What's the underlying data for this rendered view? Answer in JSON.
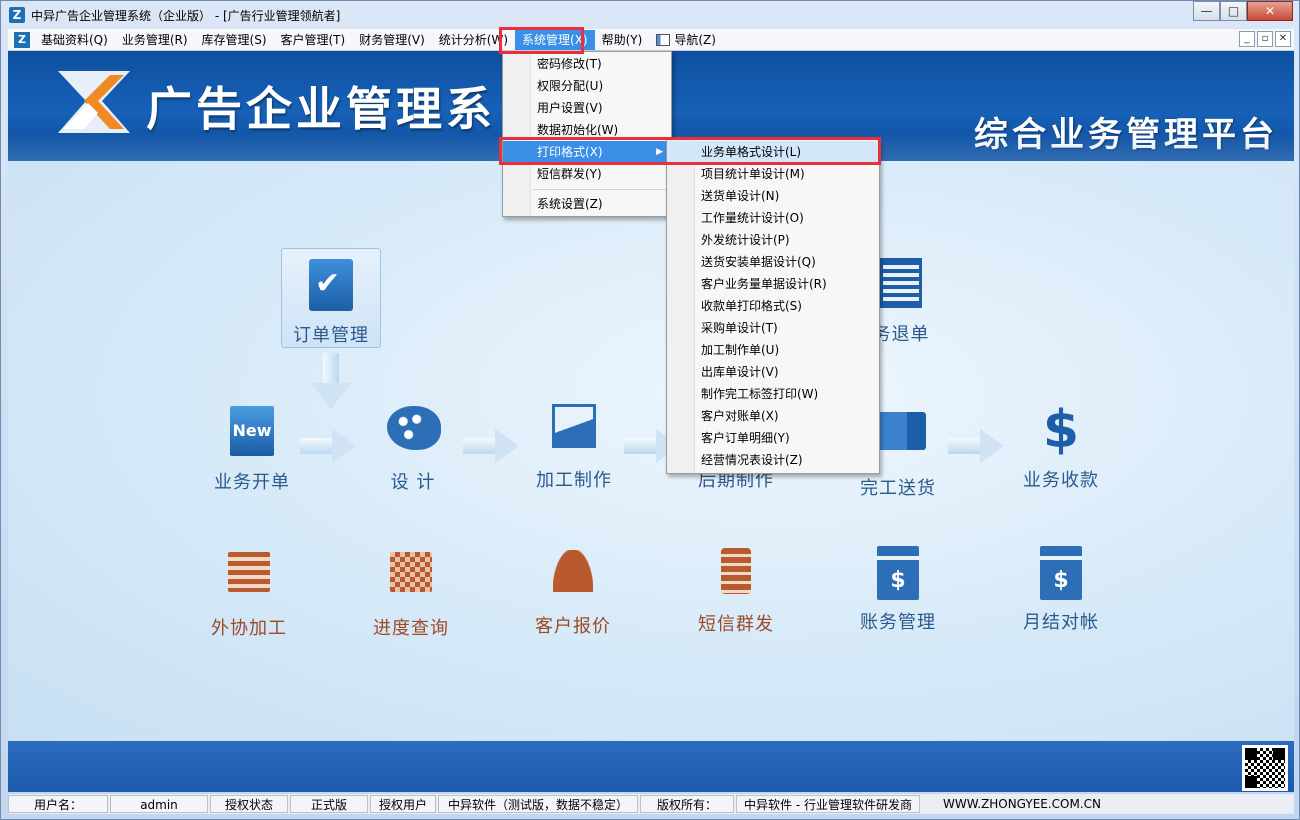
{
  "window": {
    "title": "中异广告企业管理系统（企业版） - [广告行业管理领航者]",
    "controls": [
      "—",
      "□",
      "✕"
    ]
  },
  "menubar": {
    "items": [
      {
        "label": "基础资料(Q)"
      },
      {
        "label": "业务管理(R)"
      },
      {
        "label": "库存管理(S)"
      },
      {
        "label": "客户管理(T)"
      },
      {
        "label": "财务管理(V)"
      },
      {
        "label": "统计分析(W)"
      },
      {
        "label": "系统管理(X)",
        "active": true
      },
      {
        "label": "帮助(Y)"
      },
      {
        "label": "导航(Z)"
      }
    ],
    "mdi_controls": [
      "_",
      "▫",
      "✕"
    ]
  },
  "banner": {
    "title": "广告企业管理系",
    "subtitle": "综合业务管理平台"
  },
  "system_menu": {
    "items": [
      "密码修改(T)",
      "权限分配(U)",
      "用户设置(V)",
      "数据初始化(W)",
      "打印格式(X)",
      "短信群发(Y)"
    ],
    "after_separator": [
      "系统设置(Z)"
    ],
    "active_index": 4
  },
  "print_submenu": {
    "items": [
      "业务单格式设计(L)",
      "项目统计单设计(M)",
      "送货单设计(N)",
      "工作量统计设计(O)",
      "外发统计设计(P)",
      "送货安装单据设计(Q)",
      "客户业务量单据设计(R)",
      "收款单打印格式(S)",
      "采购单设计(T)",
      "加工制作单(U)",
      "出库单设计(V)",
      "制作完工标签打印(W)",
      "客户对账单(X)",
      "客户订单明细(Y)",
      "经营情况表设计(Z)"
    ],
    "highlight_index": 0
  },
  "tiles": {
    "order": "订单管理",
    "new_order": "业务开单",
    "design": "设  计",
    "processing": "加工制作",
    "post": "后期制作",
    "delivery": "完工送货",
    "collection": "业务收款",
    "return": "务退单",
    "outsource": "外协加工",
    "progress": "进度查询",
    "quote": "客户报价",
    "sms": "短信群发",
    "accounts": "账务管理",
    "monthly": "月结对帐",
    "new_badge": "New"
  },
  "statusbar": {
    "user_label": "用户名：",
    "user_value": "admin",
    "auth_label": "授权状态",
    "auth_value": "正式版",
    "licensee_label": "授权用户",
    "licensee_value": "中异软件（测试版，数据不稳定）",
    "copyright_label": "版权所有：",
    "copyright_value": "中异软件 - 行业管理软件研发商",
    "website": "WWW.ZHONGYEE.COM.CN"
  },
  "colors": {
    "accent": "#3a8ee6",
    "highlight_red": "#e8303a",
    "banner_blue": "#1761b8",
    "brown_label": "#9b4b26"
  }
}
